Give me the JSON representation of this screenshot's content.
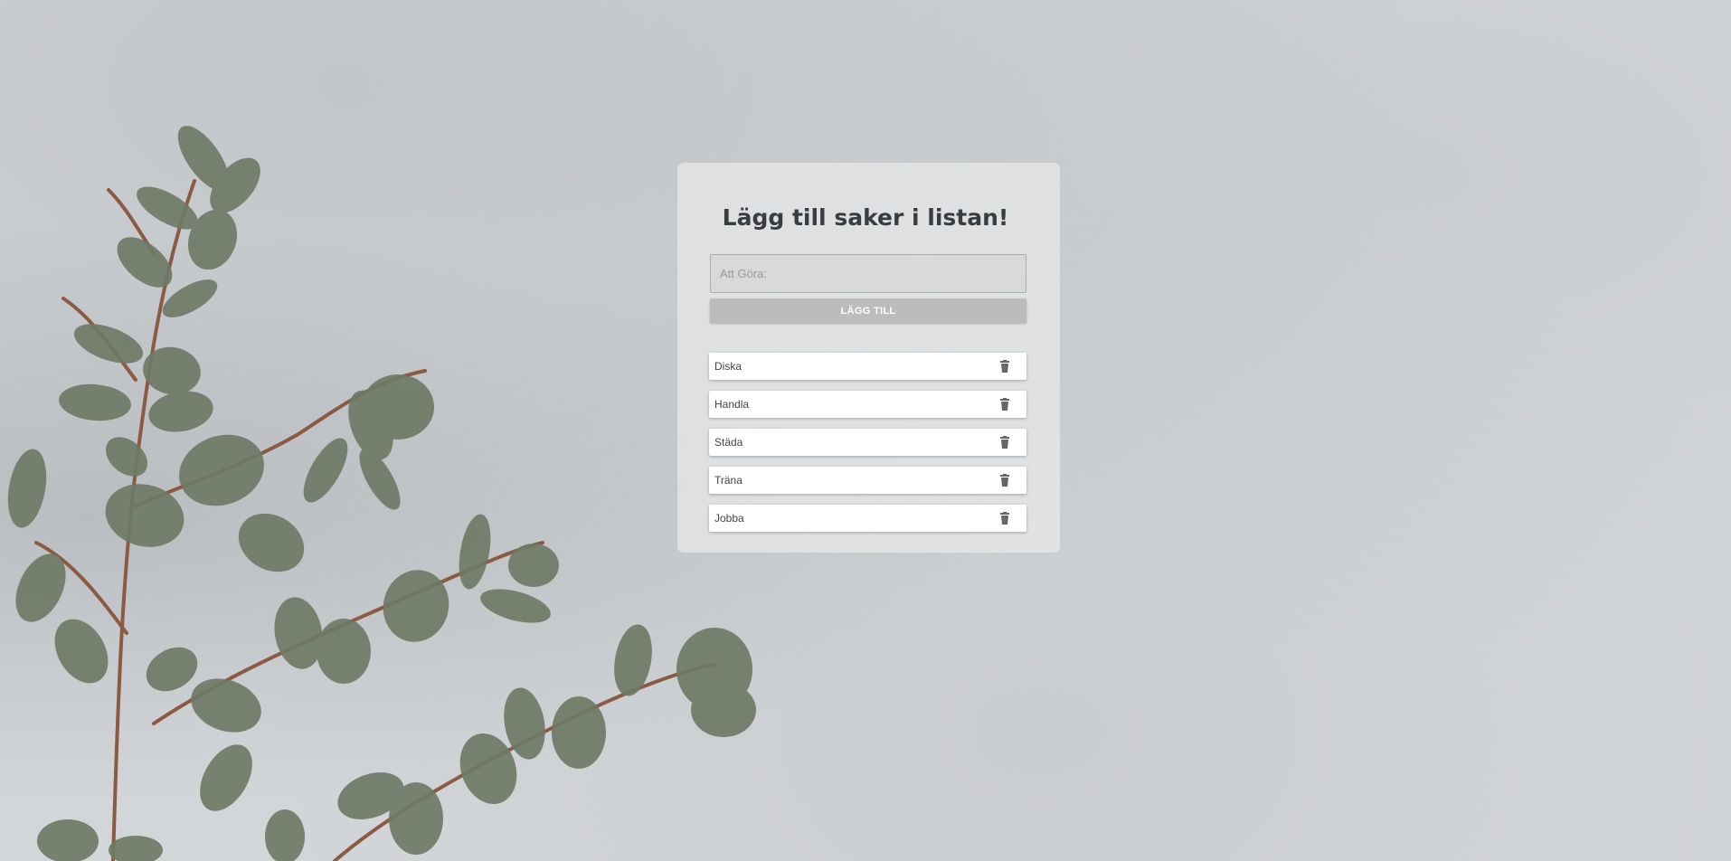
{
  "header": {
    "title": "Lägg till saker i listan!"
  },
  "form": {
    "input_placeholder": "Att Göra:",
    "input_value": "",
    "add_button_label": "LÄGG TILL"
  },
  "todo_list": {
    "items": [
      {
        "label": "Diska",
        "delete_icon": "trash-icon"
      },
      {
        "label": "Handla",
        "delete_icon": "trash-icon"
      },
      {
        "label": "Städa",
        "delete_icon": "trash-icon"
      },
      {
        "label": "Träna",
        "delete_icon": "trash-icon"
      },
      {
        "label": "Jobba",
        "delete_icon": "trash-icon"
      }
    ]
  },
  "colors": {
    "background": "#d3d6d9",
    "card": "#e8e9ea",
    "title_text": "#3a3d40",
    "button": "#bcbcbc",
    "item_bg": "#ffffff",
    "trash_icon": "#666666"
  }
}
